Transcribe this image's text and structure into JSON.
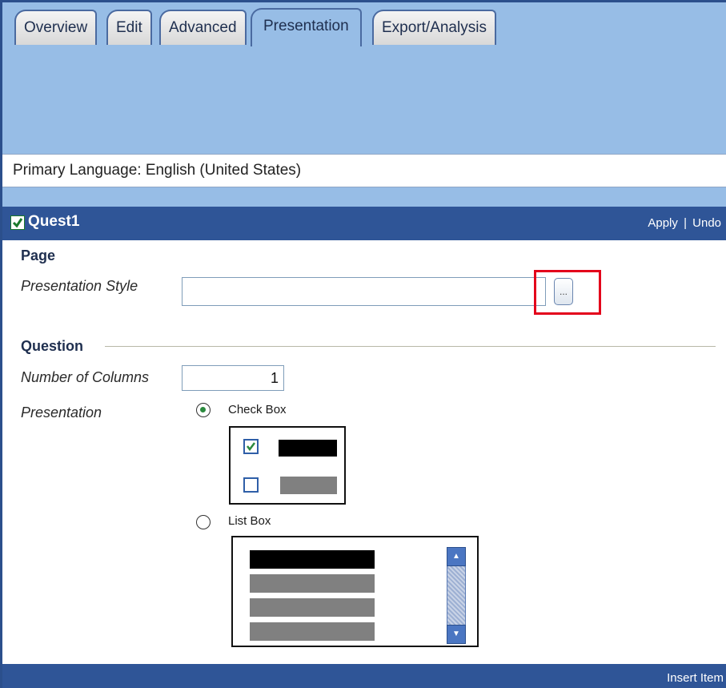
{
  "tabs": [
    {
      "label": "Overview"
    },
    {
      "label": "Edit"
    },
    {
      "label": "Advanced"
    },
    {
      "label": "Presentation"
    },
    {
      "label": "Export/Analysis"
    }
  ],
  "language_bar": {
    "text": "Primary Language: English (United States)"
  },
  "panel": {
    "title": "Quest1",
    "apply_label": "Apply",
    "separator": "|",
    "undo_label": "Undo"
  },
  "page_section": {
    "heading": "Page",
    "presentation_style_label": "Presentation Style",
    "presentation_style_value": "",
    "browse_label": "..."
  },
  "question_section": {
    "heading": "Question",
    "columns_label": "Number of Columns",
    "columns_value": "1",
    "presentation_label": "Presentation",
    "options": [
      {
        "label": "Check Box",
        "selected": true
      },
      {
        "label": "List Box",
        "selected": false
      }
    ]
  },
  "footer": {
    "insert_label": "Insert Item"
  },
  "colors": {
    "header_blue": "#2f5597",
    "band_blue": "#97bde6",
    "highlight_red": "#e3001b",
    "radio_green": "#2b8a3e"
  },
  "icons": [
    "checkbox-checked-icon",
    "browse-icon",
    "radio-icon",
    "scroll-up-icon",
    "scroll-down-icon"
  ]
}
